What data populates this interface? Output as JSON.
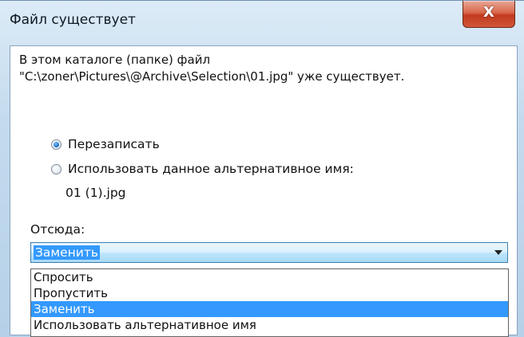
{
  "window": {
    "title": "Файл существует",
    "close_glyph": "X"
  },
  "message": {
    "line1": "В этом каталоге (папке) файл",
    "line2": "\"C:\\zoner\\Pictures\\@Archive\\Selection\\01.jpg\" уже существует."
  },
  "options": {
    "overwrite_label": "Перезаписать",
    "use_alt_label": "Использовать данное альтернативное имя:",
    "alt_name": "01 (1).jpg",
    "selected": "overwrite"
  },
  "from": {
    "label": "Отсюда:",
    "selected_value": "Заменить",
    "items": [
      "Спросить",
      "Пропустить",
      "Заменить",
      "Использовать альтернативное имя"
    ],
    "highlighted_index": 2
  },
  "colors": {
    "selection": "#3399ff",
    "close_button": "#c94a2c"
  }
}
